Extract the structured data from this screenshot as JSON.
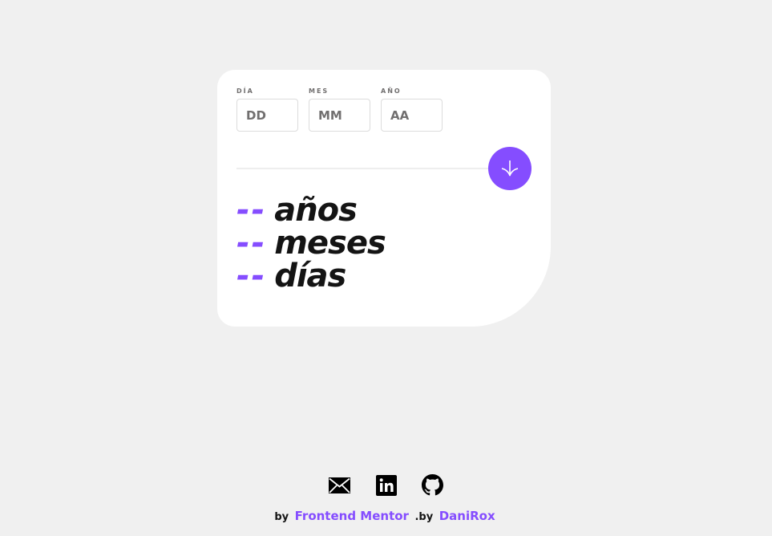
{
  "form": {
    "day": {
      "label": "DÍA",
      "placeholder": "DD",
      "value": ""
    },
    "month": {
      "label": "MES",
      "placeholder": "MM",
      "value": ""
    },
    "year": {
      "label": "AÑO",
      "placeholder": "AA",
      "value": ""
    },
    "submit_icon": "arrow-down-icon"
  },
  "results": {
    "years": {
      "value": "--",
      "unit": "años"
    },
    "months": {
      "value": "--",
      "unit": "meses"
    },
    "days": {
      "value": "--",
      "unit": "días"
    }
  },
  "footer": {
    "social_icons": [
      "mail-icon",
      "linkedin-icon",
      "github-icon"
    ],
    "attribution": {
      "prefix": "by",
      "link1": "Frontend Mentor",
      "separator": ".by",
      "link2": "DaniRox"
    }
  },
  "colors": {
    "accent": "#854dff",
    "background": "#f0f0f0",
    "card": "#ffffff",
    "text": "#141414",
    "muted": "#716f6f"
  }
}
